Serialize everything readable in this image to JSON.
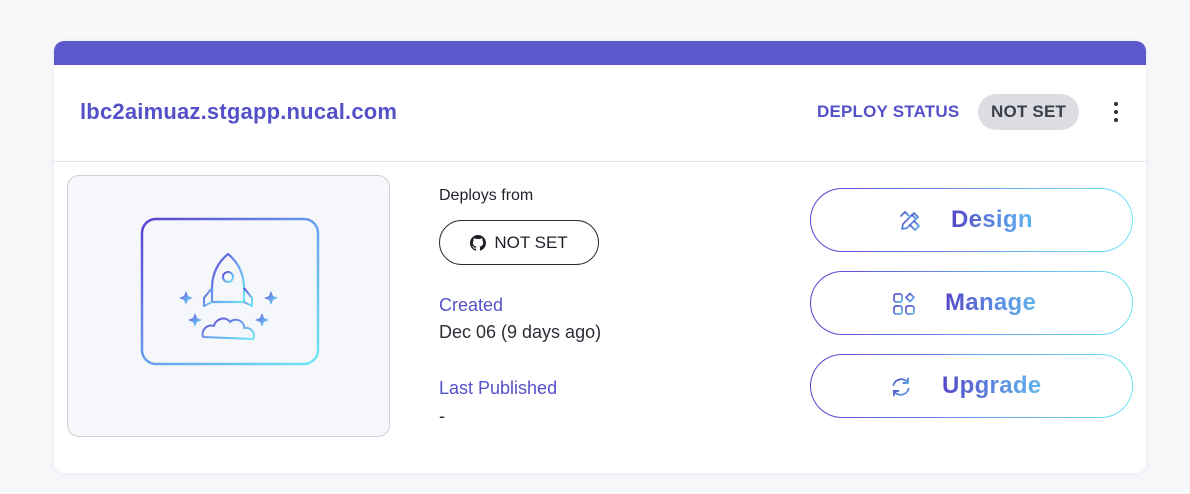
{
  "site": {
    "domain": "lbc2aimuaz.stgapp.nucal.com"
  },
  "deploy_status": {
    "label": "DEPLOY STATUS",
    "value": "NOT SET"
  },
  "menu": {
    "icon": "more-vertical-icon"
  },
  "preview": {
    "icon": "rocket-monitor-icon"
  },
  "deploys_from": {
    "label": "Deploys from",
    "repo_icon": "github-icon",
    "repo_value": "NOT SET"
  },
  "created": {
    "label": "Created",
    "value": "Dec 06 (9 days ago)"
  },
  "last_published": {
    "label": "Last Published",
    "value": "-"
  },
  "actions": [
    {
      "label": "Design",
      "icon": "design-tools-icon"
    },
    {
      "label": "Manage",
      "icon": "apps-grid-icon"
    },
    {
      "label": "Upgrade",
      "icon": "refresh-icon"
    }
  ],
  "colors": {
    "brand": "#5b57cc",
    "gradient_start": "#5b3fcf",
    "gradient_end": "#70e6f4",
    "badge_bg": "#dcdde2"
  }
}
